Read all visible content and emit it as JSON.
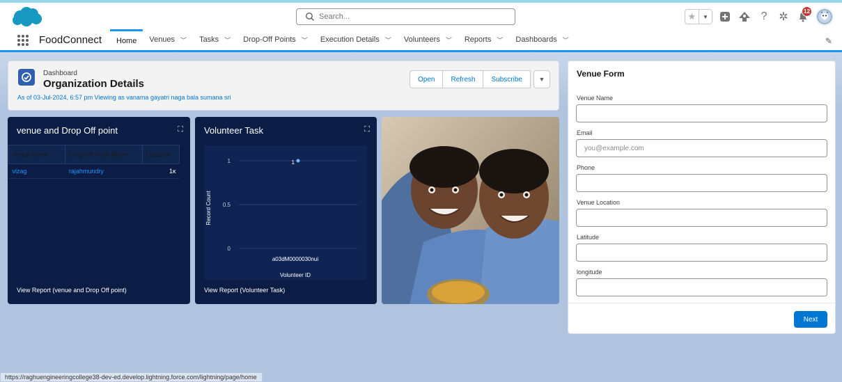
{
  "colors": {
    "brand": "#0176d3",
    "nav_active": "#1b96ff",
    "widget_bg": "#0b1d44",
    "badge": "#c23934"
  },
  "header": {
    "logo_icon": "cloud-logo",
    "search_placeholder": "Search...",
    "notification_count": "12",
    "icons": [
      "star-icon",
      "chevron-down-icon",
      "plus-icon",
      "trailhead-icon",
      "help-icon",
      "gear-icon",
      "bell-icon",
      "avatar"
    ]
  },
  "nav": {
    "app_name": "FoodConnect",
    "items": [
      {
        "label": "Home",
        "active": true,
        "dropdown": false
      },
      {
        "label": "Venues",
        "dropdown": true
      },
      {
        "label": "Tasks",
        "dropdown": true
      },
      {
        "label": "Drop-Off Points",
        "dropdown": true
      },
      {
        "label": "Execution Details",
        "dropdown": true
      },
      {
        "label": "Volunteers",
        "dropdown": true
      },
      {
        "label": "Reports",
        "dropdown": true
      },
      {
        "label": "Dashboards",
        "dropdown": true
      }
    ]
  },
  "dashboard": {
    "type_label": "Dashboard",
    "title": "Organization Details",
    "subtitle": "As of 03-Jul-2024, 6:57 pm Viewing as vanama gayatri naga bala sumana sri",
    "buttons": {
      "open": "Open",
      "refresh": "Refresh",
      "subscribe": "Subscribe"
    }
  },
  "widget_table": {
    "title": "venue and Drop Off point",
    "columns": [
      "Venue Name ↑",
      "Drop-Off Point Name",
      "Distance"
    ],
    "rows": [
      [
        "vizag",
        "rajahmundry",
        "1ĸ"
      ]
    ],
    "footer": "View Report (venue and Drop Off point)"
  },
  "widget_chart": {
    "title": "Volunteer Task",
    "footer": "View Report (Volunteer Task)"
  },
  "chart_data": {
    "type": "scatter",
    "title": "Volunteer Task",
    "xlabel": "Volunteer ID",
    "ylabel": "Record Count",
    "categories": [
      "a03dM0000030nui"
    ],
    "values": [
      1
    ],
    "data_labels": [
      "1"
    ],
    "ylim": [
      0,
      1
    ],
    "yticks": [
      "1",
      "0.5",
      "0"
    ],
    "grid": true
  },
  "venue_form": {
    "title": "Venue Form",
    "fields": [
      {
        "label": "Venue Name",
        "placeholder": ""
      },
      {
        "label": "Email",
        "placeholder": "you@example.com"
      },
      {
        "label": "Phone",
        "placeholder": ""
      },
      {
        "label": "Venue Location",
        "placeholder": ""
      },
      {
        "label": "Latitude",
        "placeholder": ""
      },
      {
        "label": "longitude",
        "placeholder": ""
      }
    ],
    "next_label": "Next"
  },
  "status_url": "https://raghuengineeringcollege38-dev-ed.develop.lightning.force.com/lightning/page/home"
}
